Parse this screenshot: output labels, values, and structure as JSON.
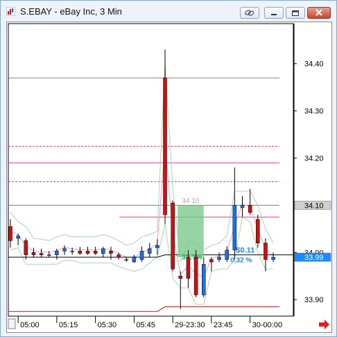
{
  "window": {
    "title": "S.EBAY - eBay Inc, 3 Min"
  },
  "toolbar": {
    "link_icon": "link-icon",
    "minimize_icon": "minimize-icon",
    "restore_icon": "restore-icon",
    "close_icon": "close-icon"
  },
  "scroll": {
    "arrow_icon": "right-arrow-icon"
  },
  "chart_data": {
    "type": "candlestick",
    "title": "S.EBAY - eBay Inc, 3 Min",
    "ylim": [
      33.865,
      34.485
    ],
    "yticks": [
      "34.40",
      "34.30",
      "34.20",
      "34.10",
      "34.00",
      "33.90"
    ],
    "xlabels": [
      {
        "text": "05:00",
        "i": 1
      },
      {
        "text": "05:15",
        "i": 6
      },
      {
        "text": "05:30",
        "i": 11
      },
      {
        "text": "05:45",
        "i": 16
      },
      {
        "text": "29-23:30",
        "i": 21
      },
      {
        "text": "23:45",
        "i": 26
      },
      {
        "text": "30-00:00",
        "i": 31
      }
    ],
    "candles": [
      {
        "o": 34.055,
        "h": 34.07,
        "l": 34.01,
        "c": 34.025
      },
      {
        "o": 34.03,
        "h": 34.04,
        "l": 34.015,
        "c": 34.035
      },
      {
        "o": 34.025,
        "h": 34.03,
        "l": 33.985,
        "c": 33.995
      },
      {
        "o": 34.0,
        "h": 34.01,
        "l": 33.99,
        "c": 33.995
      },
      {
        "o": 33.998,
        "h": 34.008,
        "l": 33.99,
        "c": 33.995
      },
      {
        "o": 33.995,
        "h": 34.003,
        "l": 33.99,
        "c": 33.995
      },
      {
        "o": 33.995,
        "h": 34.008,
        "l": 33.985,
        "c": 34.003
      },
      {
        "o": 34.003,
        "h": 34.015,
        "l": 33.995,
        "c": 34.008
      },
      {
        "o": 34.003,
        "h": 34.01,
        "l": 33.995,
        "c": 34.003
      },
      {
        "o": 34.003,
        "h": 34.012,
        "l": 33.995,
        "c": 33.998
      },
      {
        "o": 34.003,
        "h": 34.012,
        "l": 33.995,
        "c": 33.998
      },
      {
        "o": 34.003,
        "h": 34.012,
        "l": 33.995,
        "c": 33.998
      },
      {
        "o": 33.998,
        "h": 34.012,
        "l": 33.99,
        "c": 34.008
      },
      {
        "o": 34.003,
        "h": 34.012,
        "l": 33.985,
        "c": 33.998
      },
      {
        "o": 33.995,
        "h": 34.0,
        "l": 33.985,
        "c": 33.99
      },
      {
        "o": 33.985,
        "h": 33.99,
        "l": 33.98,
        "c": 33.985
      },
      {
        "o": 33.98,
        "h": 33.995,
        "l": 33.978,
        "c": 33.99
      },
      {
        "o": 33.985,
        "h": 34.013,
        "l": 33.98,
        "c": 34.003
      },
      {
        "o": 33.998,
        "h": 34.02,
        "l": 33.99,
        "c": 34.008
      },
      {
        "o": 34.01,
        "h": 34.028,
        "l": 33.995,
        "c": 34.015
      },
      {
        "o": 34.37,
        "h": 34.43,
        "l": 34.06,
        "c": 34.08
      },
      {
        "o": 34.105,
        "h": 34.11,
        "l": 33.96,
        "c": 33.965
      },
      {
        "o": 33.95,
        "h": 33.96,
        "l": 33.88,
        "c": 33.945
      },
      {
        "o": 33.99,
        "h": 34.005,
        "l": 33.925,
        "c": 33.945
      },
      {
        "o": 33.99,
        "h": 34.005,
        "l": 33.905,
        "c": 33.91
      },
      {
        "o": 33.91,
        "h": 33.99,
        "l": 33.905,
        "c": 33.975
      },
      {
        "o": 33.985,
        "h": 33.99,
        "l": 33.96,
        "c": 33.98
      },
      {
        "o": 33.985,
        "h": 34.0,
        "l": 33.98,
        "c": 33.99
      },
      {
        "o": 33.985,
        "h": 34.013,
        "l": 33.98,
        "c": 34.005
      },
      {
        "o": 34.005,
        "h": 34.18,
        "l": 33.985,
        "c": 34.1
      },
      {
        "o": 34.095,
        "h": 34.12,
        "l": 34.075,
        "c": 34.1
      },
      {
        "o": 34.1,
        "h": 34.135,
        "l": 34.08,
        "c": 34.085
      },
      {
        "o": 34.07,
        "h": 34.08,
        "l": 34.01,
        "c": 34.02
      },
      {
        "o": 34.02,
        "h": 34.03,
        "l": 33.96,
        "c": 33.985
      },
      {
        "o": 33.985,
        "h": 34.0,
        "l": 33.98,
        "c": 33.99
      }
    ],
    "hlines": [
      {
        "y": 34.37,
        "color": "#808080"
      },
      {
        "y": 34.225,
        "color": "#e23a8f",
        "dash": true
      },
      {
        "y": 34.19,
        "color": "#e23a8f"
      },
      {
        "y": 34.15,
        "color": "#e23a8f",
        "dash": true
      },
      {
        "y": 34.1,
        "color": "#808080"
      },
      {
        "y": 34.075,
        "color": "#e23a8f",
        "from": 0.39
      }
    ],
    "price_labels": [
      {
        "text": "34.10",
        "y": 34.1,
        "bg": "#d0d0d0",
        "fg": "#000000"
      },
      {
        "text": "33.99",
        "y": 33.99,
        "bg": "#1e88ff",
        "fg": "#ffffff"
      }
    ],
    "annotation": {
      "label_top": "34.10",
      "label_top_y": 34.105,
      "box_from_i": 22,
      "box_to_i": 25,
      "box_top": 34.1,
      "box_bottom": 33.99,
      "mid_label": "3?.?%",
      "gain_label": "$0.11",
      "gain_pct": "0.32 %",
      "gain_y": 34.0
    }
  }
}
